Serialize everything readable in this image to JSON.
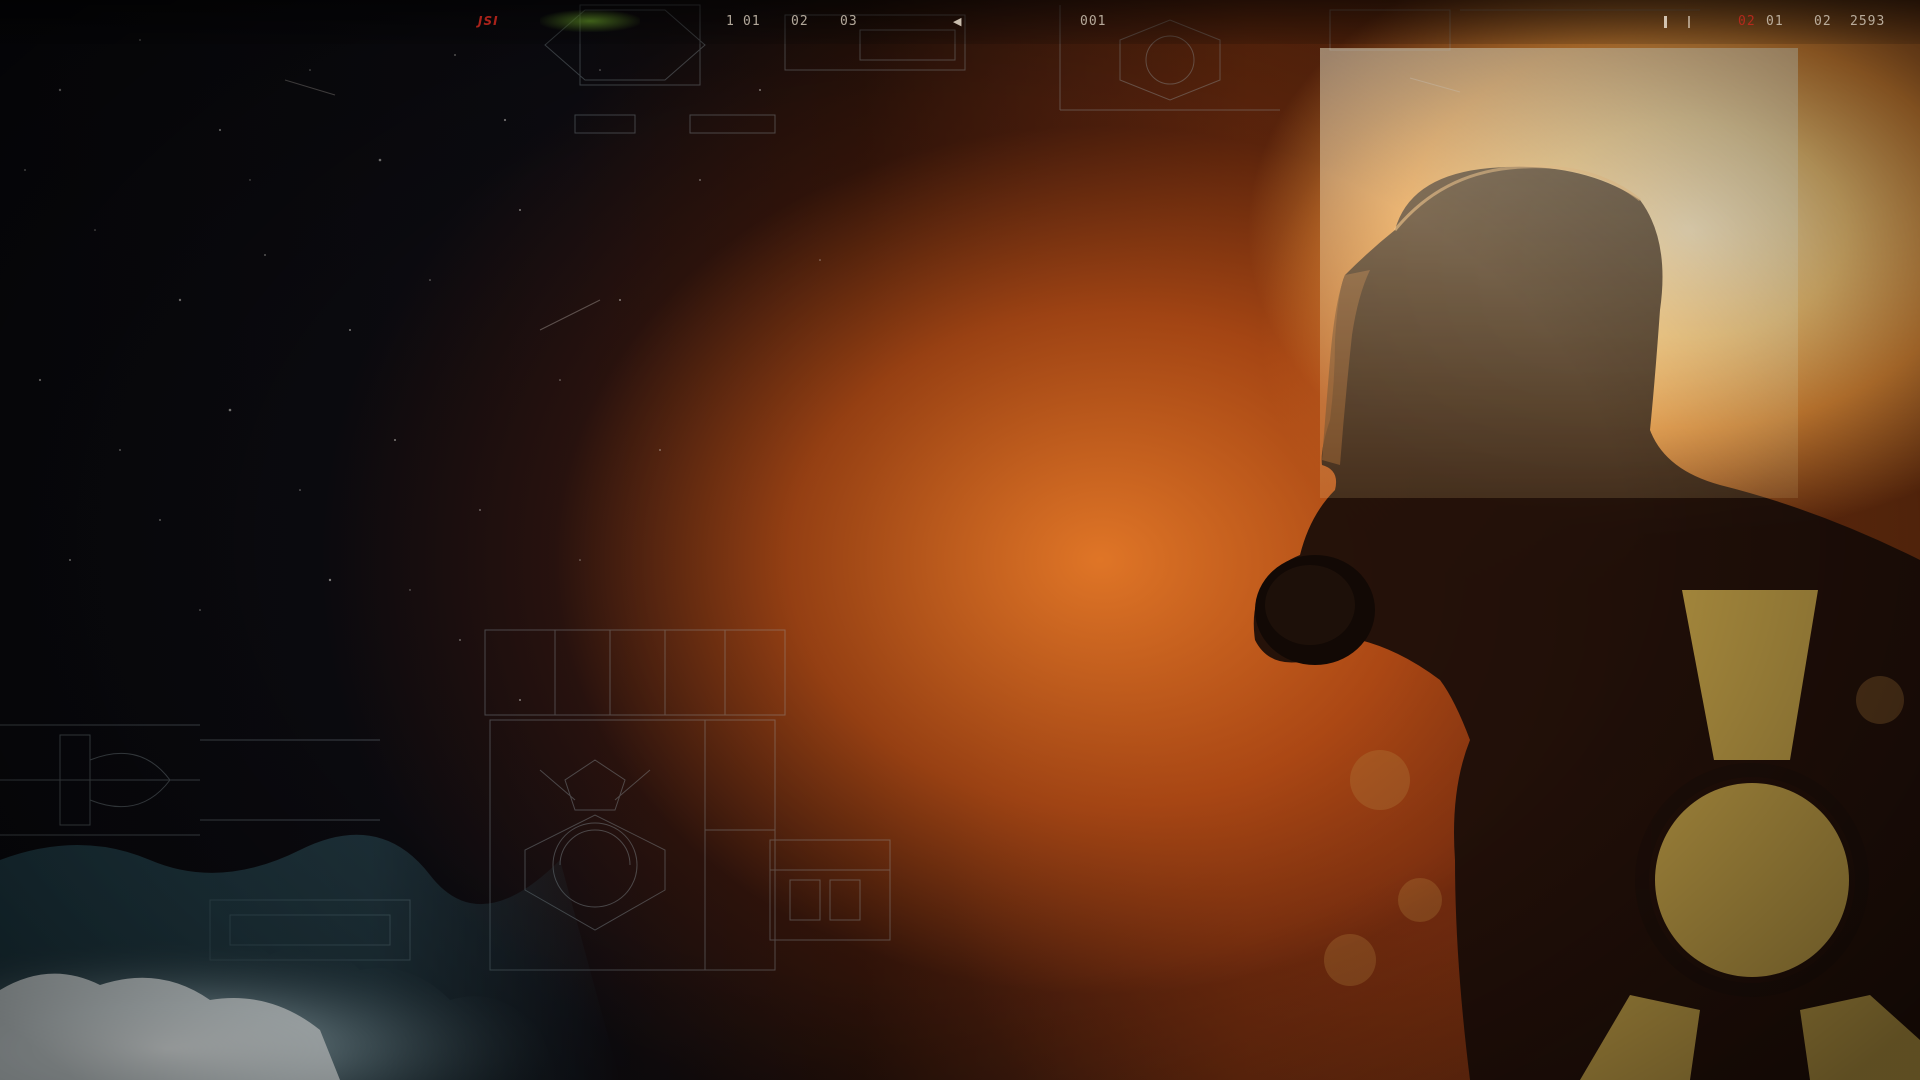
{
  "screen": {
    "name": "title-background",
    "theme_colors": {
      "glow": "#f6c878",
      "hazard_yellow": "#c9a84a",
      "shadow": "#0a0809",
      "mist_blue": "#7a96a0"
    }
  },
  "hud": {
    "left_logo_mark": "JSI",
    "counter_a": "1",
    "counter_a_sub": "01",
    "counter_b": "02",
    "counter_c": "03",
    "frame_counter": "001",
    "right_counter_red": "02",
    "right_counter_a": "01",
    "right_counter_b": "02",
    "right_counter_c": "2593"
  },
  "icons": {
    "hazard_symbol": "radiation-trefoil-icon",
    "figure": "gas-mask-silhouette"
  }
}
